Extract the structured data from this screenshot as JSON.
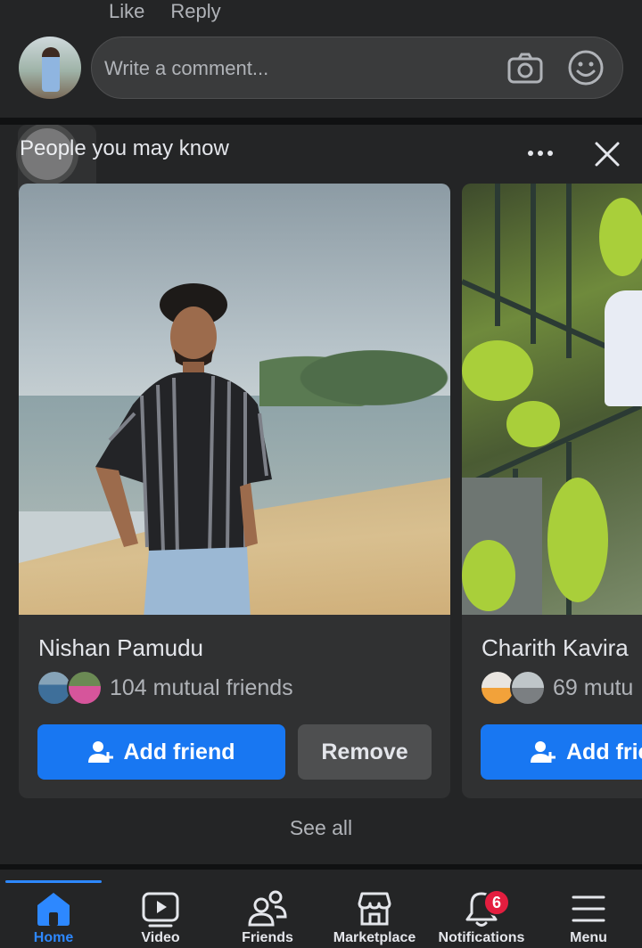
{
  "comment": {
    "actions": [
      "Like",
      "Reply"
    ],
    "input_placeholder": "Write a comment..."
  },
  "pymk": {
    "title": "People you may know",
    "cards": [
      {
        "name": "Nishan Pamudu",
        "mutual": "104 mutual friends",
        "add_label": "Add friend",
        "remove_label": "Remove"
      },
      {
        "name": "Charith Kavira",
        "mutual": "69 mutu",
        "add_label": "Add frie"
      }
    ],
    "see_all": "See all"
  },
  "tabbar": {
    "tabs": [
      {
        "label": "Home",
        "icon": "home-icon",
        "active": true
      },
      {
        "label": "Video",
        "icon": "video-icon"
      },
      {
        "label": "Friends",
        "icon": "friends-icon"
      },
      {
        "label": "Marketplace",
        "icon": "marketplace-icon"
      },
      {
        "label": "Notifications",
        "icon": "bell-icon",
        "badge": "6"
      },
      {
        "label": "Menu",
        "icon": "hamburger-icon"
      }
    ]
  },
  "colors": {
    "accent": "#1877f2",
    "active_tab": "#2d88ff",
    "badge": "#e41e3f",
    "surface": "#242526",
    "background": "#18191a"
  }
}
